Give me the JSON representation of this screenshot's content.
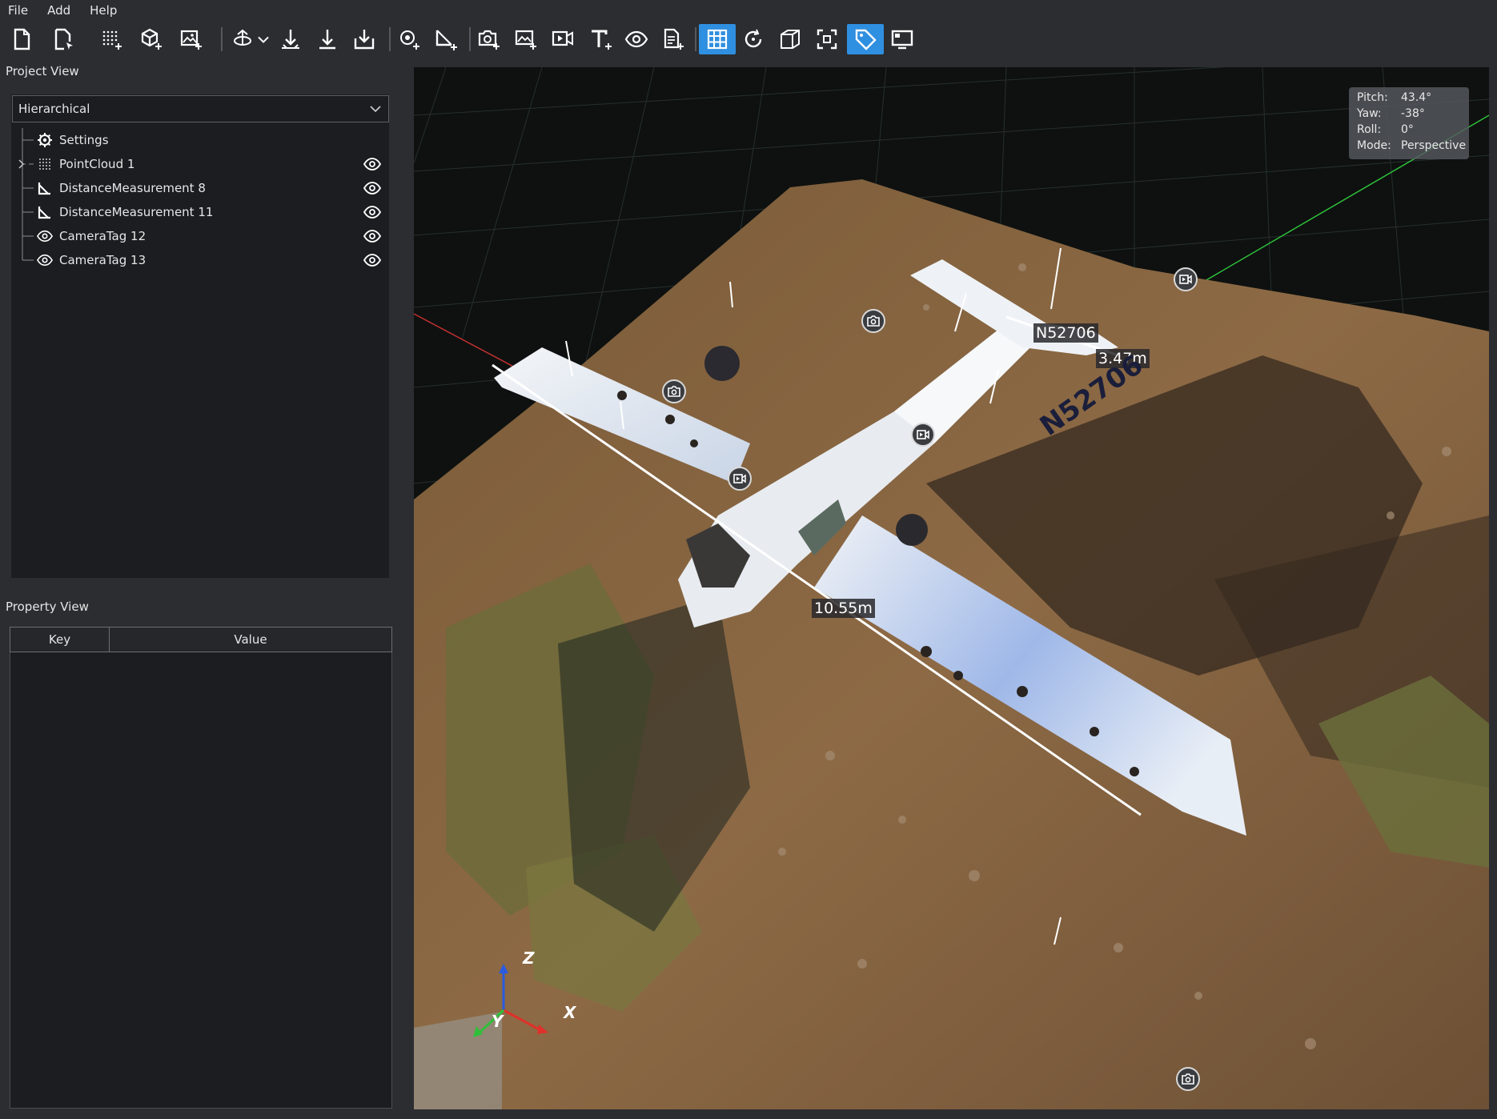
{
  "menu": {
    "items": [
      {
        "label": "File"
      },
      {
        "label": "Add"
      },
      {
        "label": "Help"
      }
    ]
  },
  "toolbar": {
    "buttons": [
      {
        "icon": "new-project-icon",
        "active": false
      },
      {
        "icon": "open-project-icon",
        "active": false
      },
      {
        "icon": "add-pointcloud-icon",
        "active": false
      },
      {
        "icon": "add-mesh-icon",
        "active": false
      },
      {
        "icon": "add-image-icon",
        "active": false
      },
      {
        "icon": "navigation-mode-icon",
        "active": false
      },
      {
        "icon": "ground-align-icon",
        "active": false
      },
      {
        "icon": "drop-down-icon",
        "active": false
      },
      {
        "icon": "export-icon",
        "active": false
      },
      {
        "icon": "add-point-marker-icon",
        "active": false
      },
      {
        "icon": "add-distance-measurement-icon",
        "active": false
      },
      {
        "icon": "add-camera-tag-icon",
        "active": false
      },
      {
        "icon": "add-image-tag-icon",
        "active": false
      },
      {
        "icon": "add-video-tag-icon",
        "active": false
      },
      {
        "icon": "add-text-tag-icon",
        "active": false
      },
      {
        "icon": "add-view-tag-icon",
        "active": false
      },
      {
        "icon": "add-document-tag-icon",
        "active": false
      },
      {
        "icon": "toggle-grid-icon",
        "active": true
      },
      {
        "icon": "reset-rotation-icon",
        "active": false
      },
      {
        "icon": "toggle-bounding-box-icon",
        "active": false
      },
      {
        "icon": "focus-selection-icon",
        "active": false
      },
      {
        "icon": "toggle-tag-labels-icon",
        "active": true
      },
      {
        "icon": "toggle-fullscreen-icon",
        "active": false
      }
    ],
    "active_color": "#2f8fe0"
  },
  "project_view": {
    "title": "Project View",
    "mode": "Hierarchical",
    "items": [
      {
        "label": "Settings",
        "icon": "gear-icon",
        "expandable": false,
        "visible_toggle": false
      },
      {
        "label": "PointCloud 1",
        "icon": "pointcloud-icon",
        "expandable": true,
        "visible_toggle": true
      },
      {
        "label": "DistanceMeasurement 8",
        "icon": "ruler-angle-icon",
        "expandable": false,
        "visible_toggle": true
      },
      {
        "label": "DistanceMeasurement 11",
        "icon": "ruler-angle-icon",
        "expandable": false,
        "visible_toggle": true
      },
      {
        "label": "CameraTag 12",
        "icon": "eye-icon",
        "expandable": false,
        "visible_toggle": true
      },
      {
        "label": "CameraTag 13",
        "icon": "eye-icon",
        "expandable": false,
        "visible_toggle": true
      }
    ]
  },
  "property_view": {
    "title": "Property View",
    "columns": [
      "Key",
      "Value"
    ],
    "rows": []
  },
  "viewport": {
    "camera": [
      {
        "key": "Pitch:",
        "value": "43.4°"
      },
      {
        "key": "Yaw:",
        "value": "-38°"
      },
      {
        "key": "Roll:",
        "value": "0°"
      },
      {
        "key": "Mode:",
        "value": "Perspective"
      }
    ],
    "labels": {
      "tail_number": "N52706",
      "tail_measure": "3.47m",
      "wingspan_measure": "10.55m",
      "fuselage_text": "N52706"
    },
    "axes": {
      "x": "X",
      "y": "Y",
      "z": "Z"
    },
    "colors": {
      "x_axis": "#e0302a",
      "y_axis": "#2fbf3a",
      "z_axis": "#2a5be0",
      "grid": "#2f3a3a"
    }
  }
}
